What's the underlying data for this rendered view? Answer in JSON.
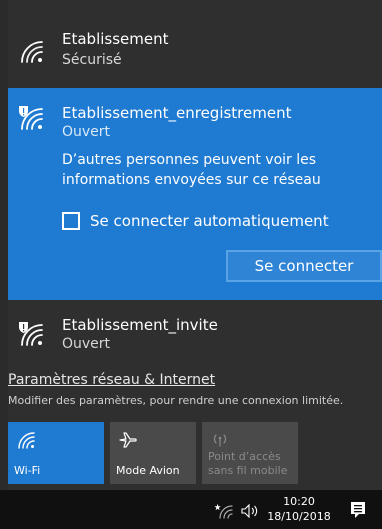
{
  "networks": [
    {
      "name": "Etablissement",
      "status": "Sécurisé",
      "icon": "wifi-icon"
    },
    {
      "name": "Etablissement_enregistrement",
      "status": "Ouvert",
      "icon": "wifi-warning-icon",
      "warning": "D’autres personnes peuvent voir les informations envoyées sur ce réseau",
      "auto_connect_label": "Se connecter automatiquement",
      "auto_connect_checked": false,
      "connect_label": "Se connecter"
    },
    {
      "name": "Etablissement_invite",
      "status": "Ouvert",
      "icon": "wifi-warning-icon"
    }
  ],
  "settings": {
    "link": "Paramètres réseau & Internet",
    "description": "Modifier des paramètres, pour rendre une connexion limitée."
  },
  "quick_actions": [
    {
      "label": "Wi-Fi",
      "icon": "wifi-icon",
      "active": true
    },
    {
      "label": "Mode Avion",
      "icon": "airplane-icon",
      "active": false
    },
    {
      "label_line1": "Point d’accès",
      "label_line2": "sans fil mobile",
      "icon": "hotspot-icon",
      "active": false,
      "disabled": true
    }
  ],
  "taskbar": {
    "time": "10:20",
    "date": "18/10/2018"
  },
  "colors": {
    "accent": "#1f7ad1",
    "panel": "#2f2f2f",
    "taskbar": "#101010"
  }
}
